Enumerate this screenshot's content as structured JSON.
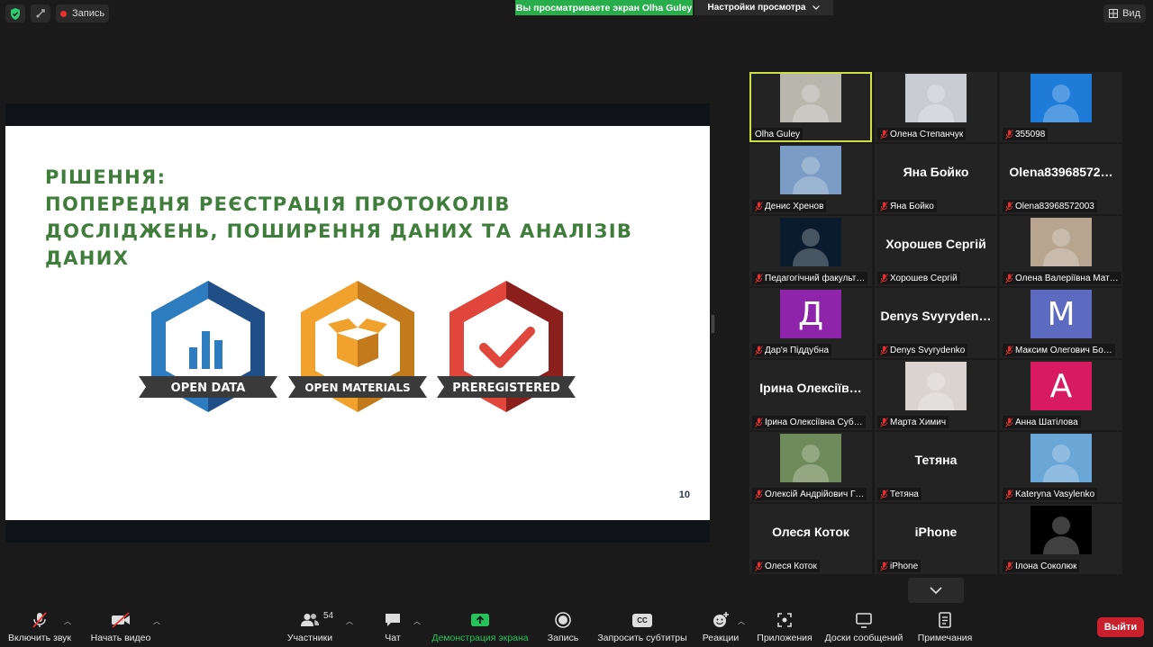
{
  "top": {
    "recording_label": "Запись",
    "share_banner": "Вы просматриваете экран Olha Guley",
    "view_options": "Настройки просмотра",
    "view_button": "Вид"
  },
  "slide": {
    "title_lines": [
      "Рішення:",
      "попередня реєстрація протоколів",
      "досліджень, поширення даних та аналізів",
      "даних"
    ],
    "page_number": "10",
    "badges": [
      {
        "label": "OPEN DATA",
        "color": "#2e7cc0",
        "dark": "#1f4f86"
      },
      {
        "label": "OPEN MATERIALS",
        "color": "#f0a12e",
        "dark": "#c27a1c"
      },
      {
        "label": "PREREGISTERED",
        "color": "#e0463b",
        "dark": "#8a1f1c"
      }
    ]
  },
  "participants": [
    {
      "label": "Olha Guley",
      "type": "video",
      "active": true,
      "muted": false,
      "bg": "#b9b6ae"
    },
    {
      "label": "Олена Степанчук",
      "type": "video",
      "muted": true,
      "bg": "#c9cdd2"
    },
    {
      "label": "355098",
      "type": "video",
      "muted": true,
      "bg": "#1e7bd8"
    },
    {
      "label": "Денис Хренов",
      "type": "video",
      "muted": true,
      "bg": "#7b9cc4"
    },
    {
      "label": "Яна Бойко",
      "type": "name",
      "display": "Яна Бойко",
      "muted": true
    },
    {
      "label": "Olena83968572003",
      "type": "name",
      "display": "Olena83968572…",
      "muted": true
    },
    {
      "label": "Педагогічний факульт…",
      "type": "video",
      "muted": true,
      "bg": "#0a1b2e"
    },
    {
      "label": "Хорошев Сергій",
      "type": "name",
      "display": "Хорошев Сергій",
      "muted": true
    },
    {
      "label": "Олена Валеріївна Мат…",
      "type": "video",
      "muted": true,
      "bg": "#b7a58f"
    },
    {
      "label": "Дар'я Піддубна",
      "type": "letter",
      "letter": "Д",
      "color": "#8e24aa",
      "muted": true
    },
    {
      "label": "Denys Svyrydenko",
      "type": "name",
      "display": "Denys Svyryden…",
      "muted": true
    },
    {
      "label": "Максим Олегович Бо…",
      "type": "letter",
      "letter": "M",
      "color": "#5c6bc0",
      "muted": true
    },
    {
      "label": "Ірина Олексіївна Суб…",
      "type": "name",
      "display": "Ірина Олексіїв…",
      "muted": true
    },
    {
      "label": "Марта Химич",
      "type": "video",
      "muted": true,
      "bg": "#d9d4d0"
    },
    {
      "label": "Анна Шатілова",
      "type": "letter",
      "letter": "A",
      "color": "#d81b60",
      "muted": true
    },
    {
      "label": "Олексій Андрійович Г…",
      "type": "video",
      "muted": true,
      "bg": "#6f8a5a"
    },
    {
      "label": "Тетяна",
      "type": "name",
      "display": "Тетяна",
      "muted": true
    },
    {
      "label": "Kateryna Vasylenko",
      "type": "video",
      "muted": true,
      "bg": "#6aa6d6"
    },
    {
      "label": "Олеся Коток",
      "type": "name",
      "display": "Олеся Коток",
      "muted": true
    },
    {
      "label": "iPhone",
      "type": "name",
      "display": "iPhone",
      "muted": true
    },
    {
      "label": "Ілона Соколюк",
      "type": "video",
      "muted": true,
      "bg": "#000000"
    }
  ],
  "toolbar": {
    "mute_label": "Включить звук",
    "video_label": "Начать видео",
    "participants_label": "Участники",
    "participants_count": "54",
    "chat_label": "Чат",
    "share_label": "Демонстрация экрана",
    "record_label": "Запись",
    "captions_label": "Запросить субтитры",
    "reactions_label": "Реакции",
    "apps_label": "Приложения",
    "whiteboards_label": "Доски сообщений",
    "notes_label": "Примечания",
    "leave_label": "Выйти",
    "cc_icon_text": "CC"
  }
}
